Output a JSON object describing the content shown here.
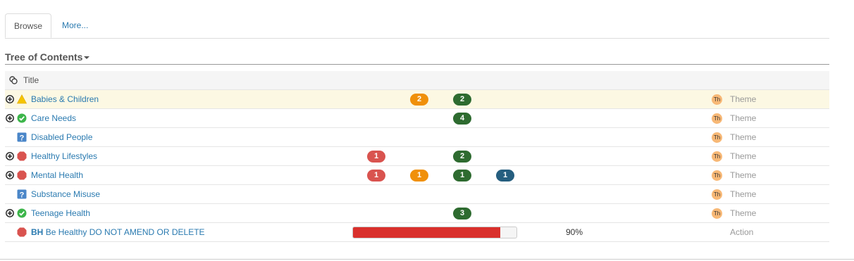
{
  "tabs": {
    "browse": "Browse",
    "more": "More..."
  },
  "section_title": "Tree of Contents",
  "table": {
    "header_title": "Title"
  },
  "colors": {
    "red": "#d9534f",
    "orange": "#f0900a",
    "green": "#2e6b30",
    "blue": "#255e7f",
    "link": "#2a7ab0",
    "progress": "#d9302c"
  },
  "rows": [
    {
      "icon": "warning-icon",
      "title": "Babies & Children",
      "expandable": true,
      "highlight": true,
      "badges": [
        {
          "color": "orange",
          "value": "2"
        },
        {
          "color": "green",
          "value": "2"
        }
      ],
      "th": "Th",
      "type": "Theme"
    },
    {
      "icon": "check-circle-icon",
      "title": "Care Needs",
      "expandable": true,
      "badges": [
        {
          "color": "green",
          "value": "4"
        }
      ],
      "th": "Th",
      "type": "Theme"
    },
    {
      "icon": "question-icon",
      "title": "Disabled People",
      "expandable": false,
      "badges": [],
      "th": "Th",
      "type": "Theme"
    },
    {
      "icon": "stop-octagon-icon",
      "title": "Healthy Lifestyles",
      "expandable": true,
      "badges": [
        {
          "color": "red",
          "value": "1"
        },
        {
          "color": "green",
          "value": "2"
        }
      ],
      "th": "Th",
      "type": "Theme"
    },
    {
      "icon": "stop-octagon-icon",
      "title": "Mental Health",
      "expandable": true,
      "badges": [
        {
          "color": "red",
          "value": "1"
        },
        {
          "color": "orange",
          "value": "1"
        },
        {
          "color": "green",
          "value": "1"
        },
        {
          "color": "blue",
          "value": "1"
        }
      ],
      "th": "Th",
      "type": "Theme"
    },
    {
      "icon": "question-icon",
      "title": "Substance Misuse",
      "expandable": false,
      "badges": [],
      "th": "Th",
      "type": "Theme"
    },
    {
      "icon": "check-circle-icon",
      "title": "Teenage Health",
      "expandable": true,
      "badges": [
        {
          "color": "green",
          "value": "3"
        }
      ],
      "th": "Th",
      "type": "Theme"
    },
    {
      "icon": "stop-octagon-icon",
      "title_prefix": "BH",
      "title": "Be Healthy DO NOT AMEND OR DELETE",
      "expandable": false,
      "badges": [],
      "progress_percent": 90,
      "progress_label": "90%",
      "type": "Action"
    }
  ]
}
